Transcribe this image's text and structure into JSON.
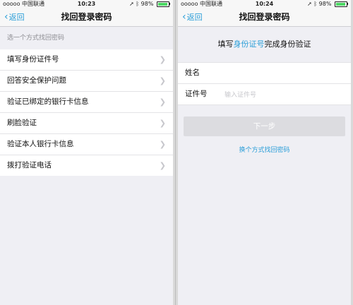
{
  "left": {
    "status": {
      "carrier": "ooooo 中国联通",
      "time": "10:23",
      "battery": "98%",
      "battery_level": 0.98
    },
    "nav": {
      "back": "返回",
      "title": "找回登录密码"
    },
    "hint": "选一个方式找回密码",
    "items": [
      {
        "label": "填写身份证件号"
      },
      {
        "label": "回答安全保护问题"
      },
      {
        "label": "验证已绑定的银行卡信息"
      },
      {
        "label": "刷脸验证"
      },
      {
        "label": "验证本人银行卡信息"
      },
      {
        "label": "拨打验证电话"
      }
    ]
  },
  "right": {
    "status": {
      "carrier": "ooooo 中国联通",
      "time": "10:24",
      "battery": "98%",
      "battery_level": 0.98
    },
    "nav": {
      "back": "返回",
      "title": "找回登录密码"
    },
    "heading": {
      "prefix": "填写",
      "highlight": "身份证号",
      "suffix": "完成身份验证"
    },
    "form": {
      "name_label": "姓名",
      "name_value": "",
      "id_label": "证件号",
      "id_placeholder": "输入证件号",
      "id_value": ""
    },
    "next_button": "下一步",
    "switch_link": "换个方式找回密码"
  },
  "colors": {
    "accent": "#2b9ed8",
    "battery": "#4cd964"
  }
}
